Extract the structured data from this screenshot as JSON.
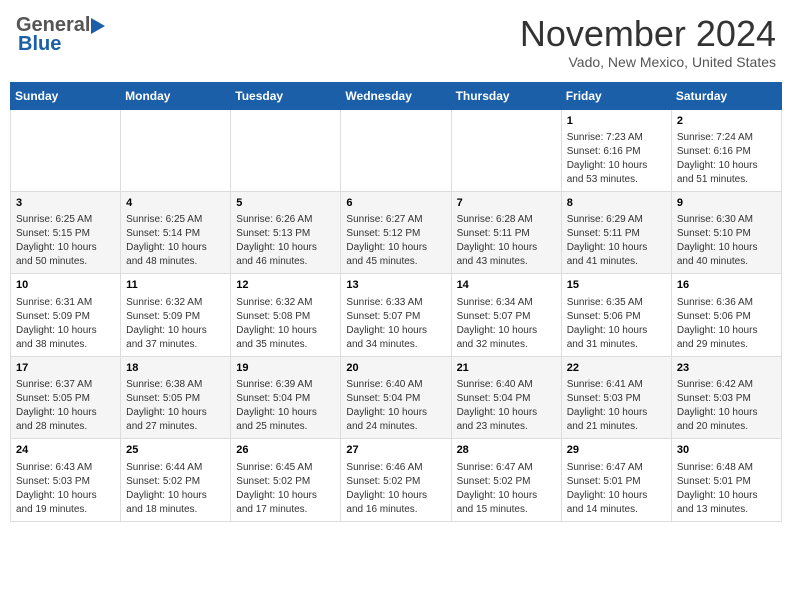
{
  "header": {
    "logo_general": "General",
    "logo_blue": "Blue",
    "month_title": "November 2024",
    "location": "Vado, New Mexico, United States"
  },
  "days_of_week": [
    "Sunday",
    "Monday",
    "Tuesday",
    "Wednesday",
    "Thursday",
    "Friday",
    "Saturday"
  ],
  "weeks": [
    {
      "id": "week1",
      "days": [
        {
          "date": "",
          "info": ""
        },
        {
          "date": "",
          "info": ""
        },
        {
          "date": "",
          "info": ""
        },
        {
          "date": "",
          "info": ""
        },
        {
          "date": "",
          "info": ""
        },
        {
          "date": "1",
          "info": "Sunrise: 7:23 AM\nSunset: 6:16 PM\nDaylight: 10 hours\nand 53 minutes."
        },
        {
          "date": "2",
          "info": "Sunrise: 7:24 AM\nSunset: 6:16 PM\nDaylight: 10 hours\nand 51 minutes."
        }
      ]
    },
    {
      "id": "week2",
      "days": [
        {
          "date": "3",
          "info": "Sunrise: 6:25 AM\nSunset: 5:15 PM\nDaylight: 10 hours\nand 50 minutes."
        },
        {
          "date": "4",
          "info": "Sunrise: 6:25 AM\nSunset: 5:14 PM\nDaylight: 10 hours\nand 48 minutes."
        },
        {
          "date": "5",
          "info": "Sunrise: 6:26 AM\nSunset: 5:13 PM\nDaylight: 10 hours\nand 46 minutes."
        },
        {
          "date": "6",
          "info": "Sunrise: 6:27 AM\nSunset: 5:12 PM\nDaylight: 10 hours\nand 45 minutes."
        },
        {
          "date": "7",
          "info": "Sunrise: 6:28 AM\nSunset: 5:11 PM\nDaylight: 10 hours\nand 43 minutes."
        },
        {
          "date": "8",
          "info": "Sunrise: 6:29 AM\nSunset: 5:11 PM\nDaylight: 10 hours\nand 41 minutes."
        },
        {
          "date": "9",
          "info": "Sunrise: 6:30 AM\nSunset: 5:10 PM\nDaylight: 10 hours\nand 40 minutes."
        }
      ]
    },
    {
      "id": "week3",
      "days": [
        {
          "date": "10",
          "info": "Sunrise: 6:31 AM\nSunset: 5:09 PM\nDaylight: 10 hours\nand 38 minutes."
        },
        {
          "date": "11",
          "info": "Sunrise: 6:32 AM\nSunset: 5:09 PM\nDaylight: 10 hours\nand 37 minutes."
        },
        {
          "date": "12",
          "info": "Sunrise: 6:32 AM\nSunset: 5:08 PM\nDaylight: 10 hours\nand 35 minutes."
        },
        {
          "date": "13",
          "info": "Sunrise: 6:33 AM\nSunset: 5:07 PM\nDaylight: 10 hours\nand 34 minutes."
        },
        {
          "date": "14",
          "info": "Sunrise: 6:34 AM\nSunset: 5:07 PM\nDaylight: 10 hours\nand 32 minutes."
        },
        {
          "date": "15",
          "info": "Sunrise: 6:35 AM\nSunset: 5:06 PM\nDaylight: 10 hours\nand 31 minutes."
        },
        {
          "date": "16",
          "info": "Sunrise: 6:36 AM\nSunset: 5:06 PM\nDaylight: 10 hours\nand 29 minutes."
        }
      ]
    },
    {
      "id": "week4",
      "days": [
        {
          "date": "17",
          "info": "Sunrise: 6:37 AM\nSunset: 5:05 PM\nDaylight: 10 hours\nand 28 minutes."
        },
        {
          "date": "18",
          "info": "Sunrise: 6:38 AM\nSunset: 5:05 PM\nDaylight: 10 hours\nand 27 minutes."
        },
        {
          "date": "19",
          "info": "Sunrise: 6:39 AM\nSunset: 5:04 PM\nDaylight: 10 hours\nand 25 minutes."
        },
        {
          "date": "20",
          "info": "Sunrise: 6:40 AM\nSunset: 5:04 PM\nDaylight: 10 hours\nand 24 minutes."
        },
        {
          "date": "21",
          "info": "Sunrise: 6:40 AM\nSunset: 5:04 PM\nDaylight: 10 hours\nand 23 minutes."
        },
        {
          "date": "22",
          "info": "Sunrise: 6:41 AM\nSunset: 5:03 PM\nDaylight: 10 hours\nand 21 minutes."
        },
        {
          "date": "23",
          "info": "Sunrise: 6:42 AM\nSunset: 5:03 PM\nDaylight: 10 hours\nand 20 minutes."
        }
      ]
    },
    {
      "id": "week5",
      "days": [
        {
          "date": "24",
          "info": "Sunrise: 6:43 AM\nSunset: 5:03 PM\nDaylight: 10 hours\nand 19 minutes."
        },
        {
          "date": "25",
          "info": "Sunrise: 6:44 AM\nSunset: 5:02 PM\nDaylight: 10 hours\nand 18 minutes."
        },
        {
          "date": "26",
          "info": "Sunrise: 6:45 AM\nSunset: 5:02 PM\nDaylight: 10 hours\nand 17 minutes."
        },
        {
          "date": "27",
          "info": "Sunrise: 6:46 AM\nSunset: 5:02 PM\nDaylight: 10 hours\nand 16 minutes."
        },
        {
          "date": "28",
          "info": "Sunrise: 6:47 AM\nSunset: 5:02 PM\nDaylight: 10 hours\nand 15 minutes."
        },
        {
          "date": "29",
          "info": "Sunrise: 6:47 AM\nSunset: 5:01 PM\nDaylight: 10 hours\nand 14 minutes."
        },
        {
          "date": "30",
          "info": "Sunrise: 6:48 AM\nSunset: 5:01 PM\nDaylight: 10 hours\nand 13 minutes."
        }
      ]
    }
  ]
}
